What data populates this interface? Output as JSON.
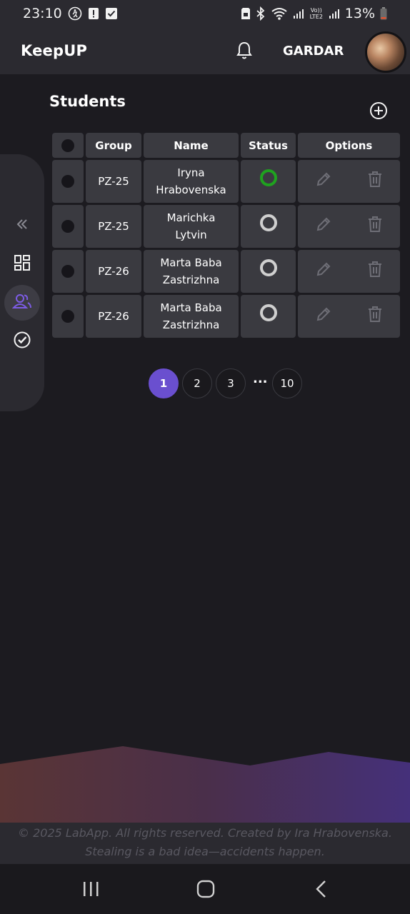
{
  "status_bar": {
    "time": "23:10",
    "battery": "13%",
    "network_label": "Vo)) LTE2"
  },
  "app": {
    "brand": "KeepUP",
    "username": "GARDAR"
  },
  "page": {
    "title": "Students"
  },
  "table": {
    "headers": [
      "Group",
      "Name",
      "Status",
      "Options"
    ],
    "rows": [
      {
        "group": "PZ-25",
        "name_line1": "Iryna",
        "name_line2": "Hrabovenska",
        "active": true
      },
      {
        "group": "PZ-25",
        "name_line1": "Marichka",
        "name_line2": "Lytvin",
        "active": false
      },
      {
        "group": "PZ-26",
        "name_line1": "Marta Baba",
        "name_line2": "Zastrizhna",
        "active": false
      },
      {
        "group": "PZ-26",
        "name_line1": "Marta Baba",
        "name_line2": "Zastrizhna",
        "active": false
      }
    ]
  },
  "pagination": {
    "pages": [
      "1",
      "2",
      "3"
    ],
    "ellipsis": "...",
    "last": "10",
    "current": "1"
  },
  "footer": {
    "line1": "© 2025 LabApp. All rights reserved. Created by Ira Hrabovenska.",
    "line2": "Stealing is a bad idea—accidents happen."
  },
  "colors": {
    "accent": "#6a4fcf",
    "status_on": "#1fa21f",
    "status_off": "#cfcfcf",
    "surface": "#2b2a30",
    "background": "#1c1b20"
  },
  "icons": {
    "sidebar": [
      "collapse-icon",
      "dashboard-icon",
      "students-icon",
      "tasks-icon"
    ],
    "row_options": [
      "edit-icon",
      "delete-icon"
    ]
  }
}
